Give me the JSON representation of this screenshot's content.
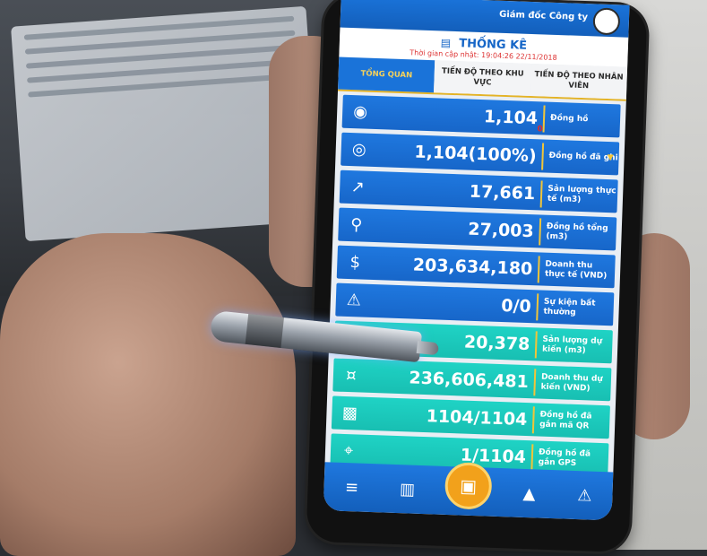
{
  "header": {
    "role": "Giám đốc Công ty",
    "title": "THỐNG KÊ",
    "update_label": "Thời gian cập nhật: 19:04:26 22/11/2018"
  },
  "tabs": [
    {
      "label": "TỔNG QUAN",
      "active": true
    },
    {
      "label": "TIẾN ĐỘ THEO KHU VỰC",
      "active": false
    },
    {
      "label": "TIẾN ĐỘ THEO NHÂN VIÊN",
      "active": false
    }
  ],
  "stats": [
    {
      "icon": "meter-icon",
      "value": "1,104",
      "sub": "0",
      "label": "Đồng hồ",
      "color": "blue"
    },
    {
      "icon": "meter-read-icon",
      "value": "1,104(100%)",
      "label": "Đồng hồ đã ghi",
      "color": "blue",
      "has_dropdown": true
    },
    {
      "icon": "chart-up-icon",
      "value": "17,661",
      "label": "Sản lượng thực tế (m3)",
      "color": "blue"
    },
    {
      "icon": "network-icon",
      "value": "27,003",
      "label": "Đồng hồ tổng (m3)",
      "color": "blue"
    },
    {
      "icon": "money-hand-icon",
      "value": "203,634,180",
      "label": "Doanh thu thực tế (VND)",
      "color": "blue"
    },
    {
      "icon": "warning-icon",
      "value": "0/0",
      "label": "Sự kiện bất thường",
      "color": "blue"
    },
    {
      "icon": "forecast-icon",
      "value": "20,378",
      "label": "Sản lượng dự kiến (m3)",
      "color": "teal"
    },
    {
      "icon": "revenue-forecast-icon",
      "value": "236,606,481",
      "label": "Doanh thu dự kiến (VND)",
      "color": "teal"
    },
    {
      "icon": "qr-icon",
      "value": "1104/1104",
      "label": "Đồng hồ đã gắn mã QR",
      "color": "teal"
    },
    {
      "icon": "gps-icon",
      "value": "1/1104",
      "label": "Đồng hồ đã gắn GPS",
      "color": "teal"
    }
  ],
  "nav": [
    "menu-icon",
    "stats-icon",
    "qr-scan-icon",
    "bell-icon",
    "warning-icon"
  ],
  "colors": {
    "primary": "#1a73d9",
    "teal": "#1fd3c5",
    "accent": "#f0c53a",
    "alert": "#e02c2c"
  }
}
